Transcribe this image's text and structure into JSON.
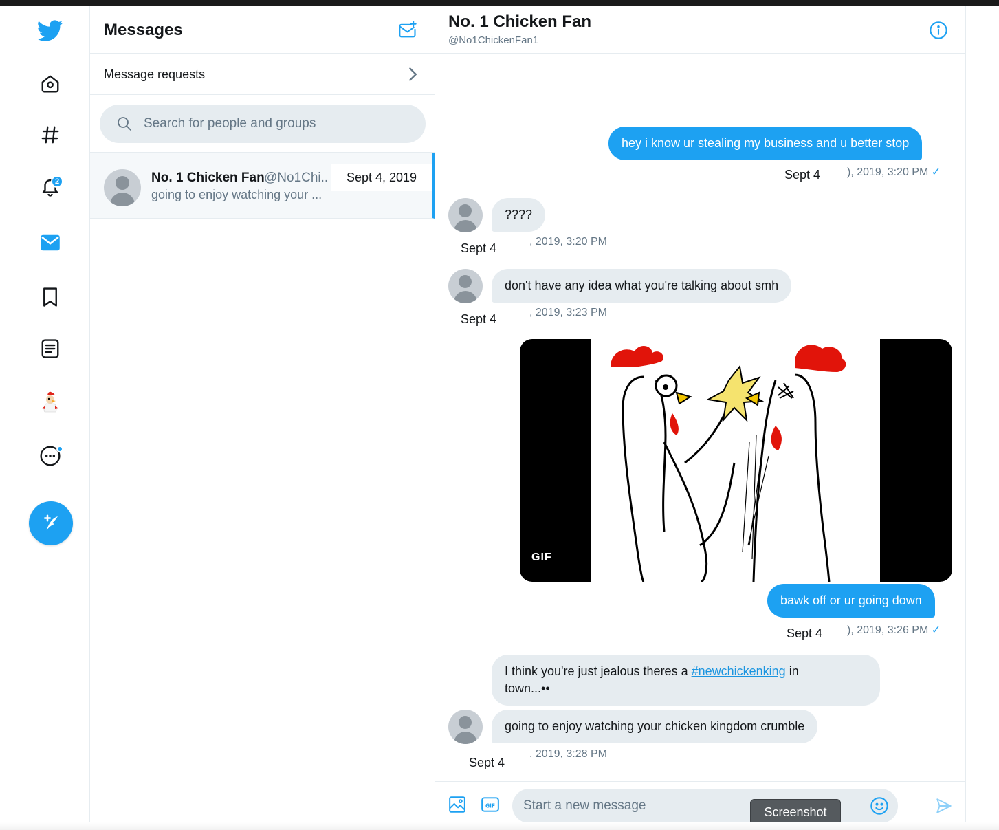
{
  "nav": {
    "notifications_badge": "2",
    "items": [
      "twitter-logo",
      "home",
      "explore",
      "notifications",
      "messages",
      "bookmarks",
      "lists",
      "profile",
      "more",
      "tweet-compose"
    ]
  },
  "messages": {
    "title": "Messages",
    "requests_label": "Message requests",
    "search_placeholder": "Search for people and groups",
    "conversation": {
      "name": "No. 1 Chicken Fan",
      "handle": "@No1Chi..",
      "date": "Sept 4, 2019",
      "preview": "going to enjoy watching your ..."
    }
  },
  "chat": {
    "name": "No. 1 Chicken Fan",
    "handle": "@No1ChickenFan1",
    "messages": [
      {
        "text": "hey i know ur stealing my business and u better stop",
        "sept": "Sept 4",
        "time": "), 2019, 3:20 PM",
        "check": "✓"
      },
      {
        "text": "????",
        "sept": "Sept 4",
        "time": ", 2019, 3:20 PM"
      },
      {
        "text": "don't have any idea what you're talking about smh",
        "sept": "Sept 4",
        "time": ", 2019, 3:23 PM"
      },
      {
        "gif_label": "GIF"
      },
      {
        "text": "bawk off or ur going down",
        "sept": "Sept 4",
        "time": "), 2019, 3:26 PM",
        "check": "✓"
      },
      {
        "text_before": "I think you're just jealous theres a ",
        "hashtag": "#newchickenking",
        "text_after": " in",
        "line2": "town...••"
      },
      {
        "text": "going to enjoy watching your chicken kingdom crumble",
        "sept": "Sept 4",
        "time": ", 2019, 3:28 PM"
      }
    ],
    "composer_placeholder": "Start a new message",
    "tooltip": "Screenshot"
  },
  "colors": {
    "accent": "#1da1f2",
    "incoming_bubble": "#e6ecf0",
    "secondary_text": "#657786"
  }
}
